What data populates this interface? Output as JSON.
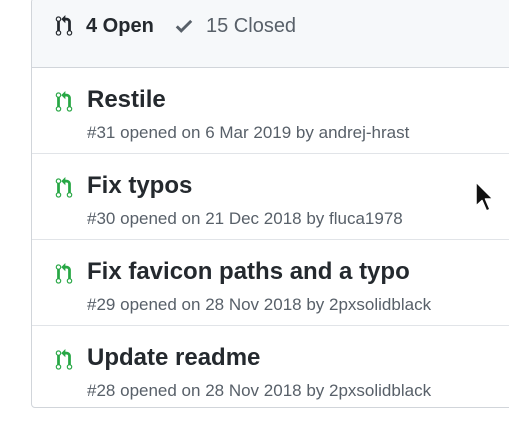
{
  "header": {
    "open_count_label": "4 Open",
    "closed_count_label": "15 Closed",
    "open_icon": "git-pull-request-icon",
    "closed_icon": "check-icon"
  },
  "colors": {
    "open_green": "#28a745",
    "muted": "#586069",
    "text": "#24292e",
    "header_bg": "#f6f8fa",
    "border": "#d1d5da"
  },
  "pull_requests": [
    {
      "icon": "git-pull-request-icon",
      "title": "Restile",
      "number": "#31",
      "opened_text": "opened on 6 Mar 2019 by",
      "author": "andrej-hrast"
    },
    {
      "icon": "git-pull-request-icon",
      "title": "Fix typos",
      "number": "#30",
      "opened_text": "opened on 21 Dec 2018 by",
      "author": "fluca1978"
    },
    {
      "icon": "git-pull-request-icon",
      "title": "Fix favicon paths and a typo",
      "number": "#29",
      "opened_text": "opened on 28 Nov 2018 by",
      "author": "2pxsolidblack"
    },
    {
      "icon": "git-pull-request-icon",
      "title": "Update readme",
      "number": "#28",
      "opened_text": "opened on 28 Nov 2018 by",
      "author": "2pxsolidblack"
    }
  ]
}
